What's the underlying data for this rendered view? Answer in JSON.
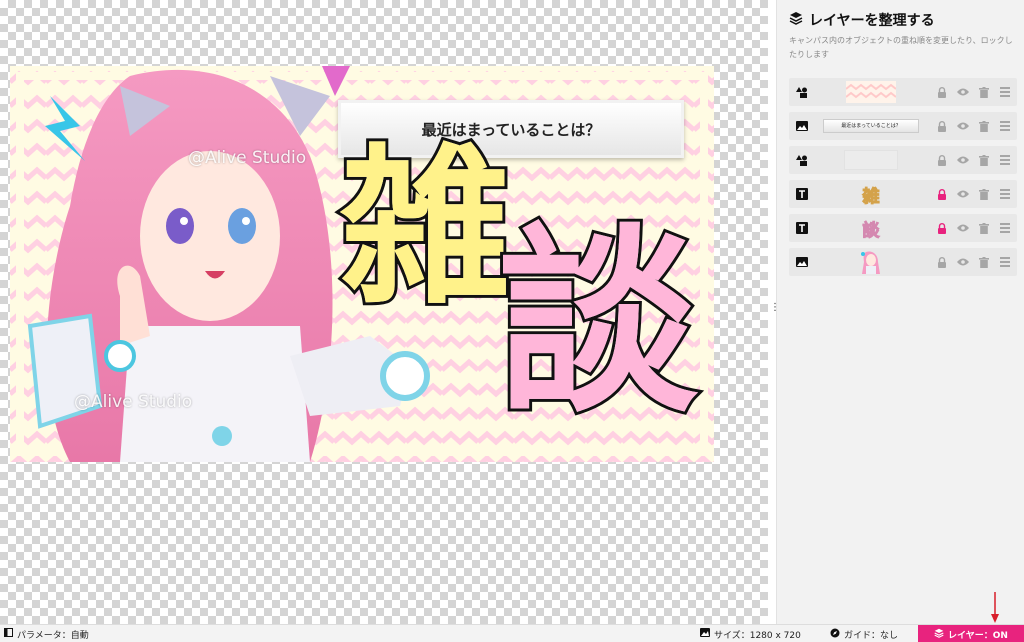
{
  "thumbnail": {
    "title_text": "最近はまっていることは？",
    "big_char_1": "雑",
    "big_char_2": "談",
    "watermark_1": "@Alive Studio",
    "watermark_2": "@Alive Studio"
  },
  "panel": {
    "title": "レイヤーを整理する",
    "description": "キャンパス内のオブジェクトの重ね順を変更したり、ロックしたりします",
    "layers": [
      {
        "type": "shape",
        "thumb": "zigzag",
        "locked": false
      },
      {
        "type": "image",
        "thumb": "title-bar",
        "thumb_text": "最近はまっていることは？",
        "locked": false
      },
      {
        "type": "shape",
        "thumb": "blank",
        "locked": false
      },
      {
        "type": "text",
        "thumb": "text-char",
        "thumb_text": "雑",
        "locked": true
      },
      {
        "type": "text",
        "thumb": "text-char",
        "thumb_text": "談",
        "locked": true
      },
      {
        "type": "image",
        "thumb": "character",
        "locked": false
      }
    ],
    "icons": {
      "lock": "lock-icon",
      "eye": "eye-icon",
      "trash": "trash-icon",
      "menu": "menu-icon"
    }
  },
  "bottombar": {
    "params": "パラメータ：自動",
    "size": "サイズ：1280 x 720",
    "guide": "ガイド：なし",
    "layer_toggle": "レイヤー：ON"
  },
  "colors": {
    "accent": "#e8237e",
    "lock_active": "#e8237e",
    "icon_gray": "#a6a6a6"
  }
}
